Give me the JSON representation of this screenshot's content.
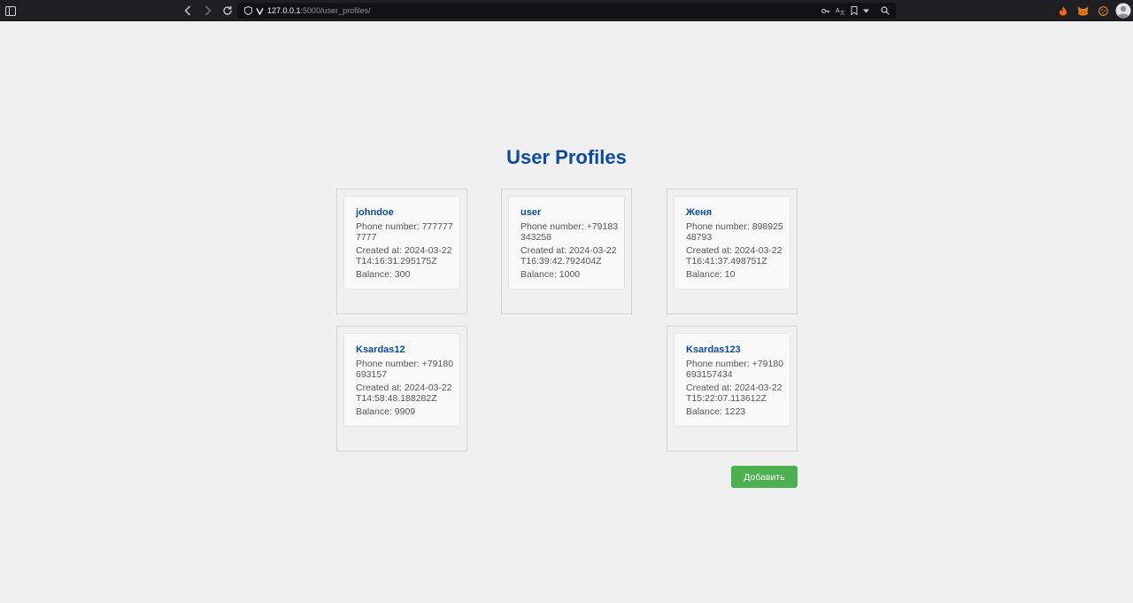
{
  "browser": {
    "url_host": "127.0.0.1",
    "url_path": ":5000/user_profiles/"
  },
  "page": {
    "title": "User Profiles",
    "add_button_label": "Добавить"
  },
  "profiles": [
    {
      "name": "johndoe",
      "phone": "Phone number: 7777777777",
      "created": "Created at: 2024-03-22T14:16:31.295175Z",
      "balance": "Balance: 300"
    },
    {
      "name": "user",
      "phone": "Phone number: +79183343258",
      "created": "Created at: 2024-03-22T16:39:42.792404Z",
      "balance": "Balance: 1000"
    },
    {
      "name": "Женя",
      "phone": "Phone number: 89892548793",
      "created": "Created at: 2024-03-22T16:41:37.498751Z",
      "balance": "Balance: 10"
    },
    {
      "name": "Ksardas12",
      "phone": "Phone number: +79180693157",
      "created": "Created at: 2024-03-22T14:58:48.188282Z",
      "balance": "Balance: 9909"
    },
    {
      "name": "Ksardas123",
      "phone": "Phone number: +79180693157434",
      "created": "Created at: 2024-03-22T15:22:07.113612Z",
      "balance": "Balance: 1223"
    }
  ],
  "icons": {
    "sidebar": "sidebar-toggle-icon",
    "back": "back-arrow-icon",
    "forward": "forward-arrow-icon",
    "reload": "reload-icon",
    "shield": "shield-icon",
    "key": "key-icon",
    "translate": "translate-icon",
    "bookmark": "bookmark-icon",
    "dropdown": "chevron-down-icon",
    "search": "search-icon",
    "extension_fox": "fox-extension-icon",
    "extension_metamask": "metamask-extension-icon",
    "extension_cookie": "cookie-extension-icon",
    "profile": "profile-avatar-icon"
  },
  "colors": {
    "title": "#0d4a9e",
    "button": "#4caf50",
    "page_background": "#f0f0f0",
    "chrome_background": "#1f1f23"
  }
}
